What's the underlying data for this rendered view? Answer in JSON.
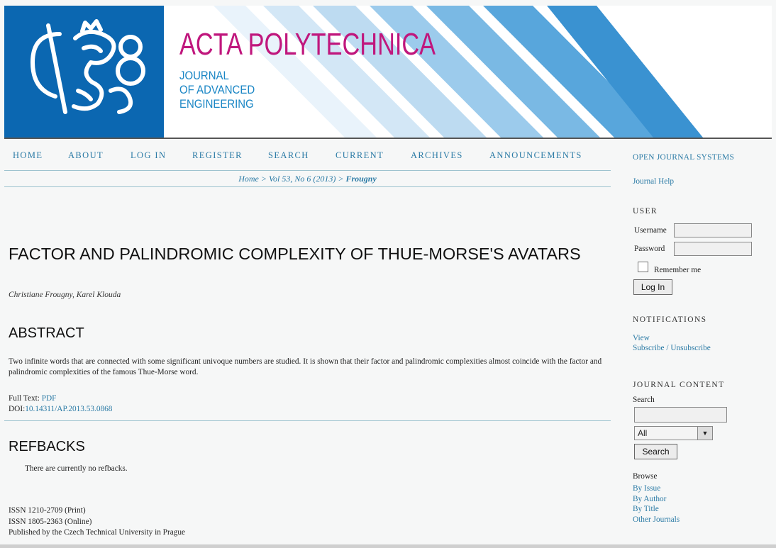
{
  "header": {
    "title": "ACTA POLYTECHNICA",
    "subtitle_lines": [
      "JOURNAL",
      "OF ADVANCED",
      "ENGINEERING"
    ],
    "colors": {
      "brand_blue": "#0b67b1",
      "title_magenta": "#c0177d",
      "stripe_blue": "#1a86c5"
    }
  },
  "nav": {
    "items": [
      "HOME",
      "ABOUT",
      "LOG IN",
      "REGISTER",
      "SEARCH",
      "CURRENT",
      "ARCHIVES",
      "ANNOUNCEMENTS"
    ]
  },
  "breadcrumb": {
    "home": "Home",
    "sep": ">",
    "issue": "Vol 53, No 6 (2013)",
    "current": "Frougny"
  },
  "article": {
    "title": "FACTOR AND PALINDROMIC COMPLEXITY OF THUE-MORSE'S AVATARS",
    "authors": "Christiane Frougny, Karel Klouda",
    "abstract_heading": "ABSTRACT",
    "abstract": "Two infinite words that are connected with some significant univoque numbers are studied. It is shown that their factor and palindromic complexities almost coincide with the factor and palindromic complexities of the famous Thue-Morse word.",
    "fulltext_label": "Full Text:",
    "fulltext_link": "PDF",
    "doi_label": "DOI:",
    "doi": "10.14311/AP.2013.53.0868",
    "refbacks_heading": "REFBACKS",
    "refbacks_text": "There are currently no refbacks."
  },
  "footer": {
    "lines": [
      "ISSN 1210-2709 (Print)",
      "ISSN 1805-2363 (Online)",
      "Published by the Czech Technical University in Prague"
    ]
  },
  "sidebar": {
    "ojs": "OPEN JOURNAL SYSTEMS",
    "journal_help": "Journal Help",
    "user_heading": "USER",
    "username_label": "Username",
    "password_label": "Password",
    "remember_label": "Remember me",
    "login_button": "Log In",
    "notifications_heading": "NOTIFICATIONS",
    "view_link": "View",
    "subscribe_link": "Subscribe / Unsubscribe",
    "journal_content_heading": "JOURNAL CONTENT",
    "search_label": "Search",
    "search_scope": "All",
    "search_button": "Search",
    "browse_label": "Browse",
    "browse_links": [
      "By Issue",
      "By Author",
      "By Title",
      "Other Journals"
    ]
  }
}
